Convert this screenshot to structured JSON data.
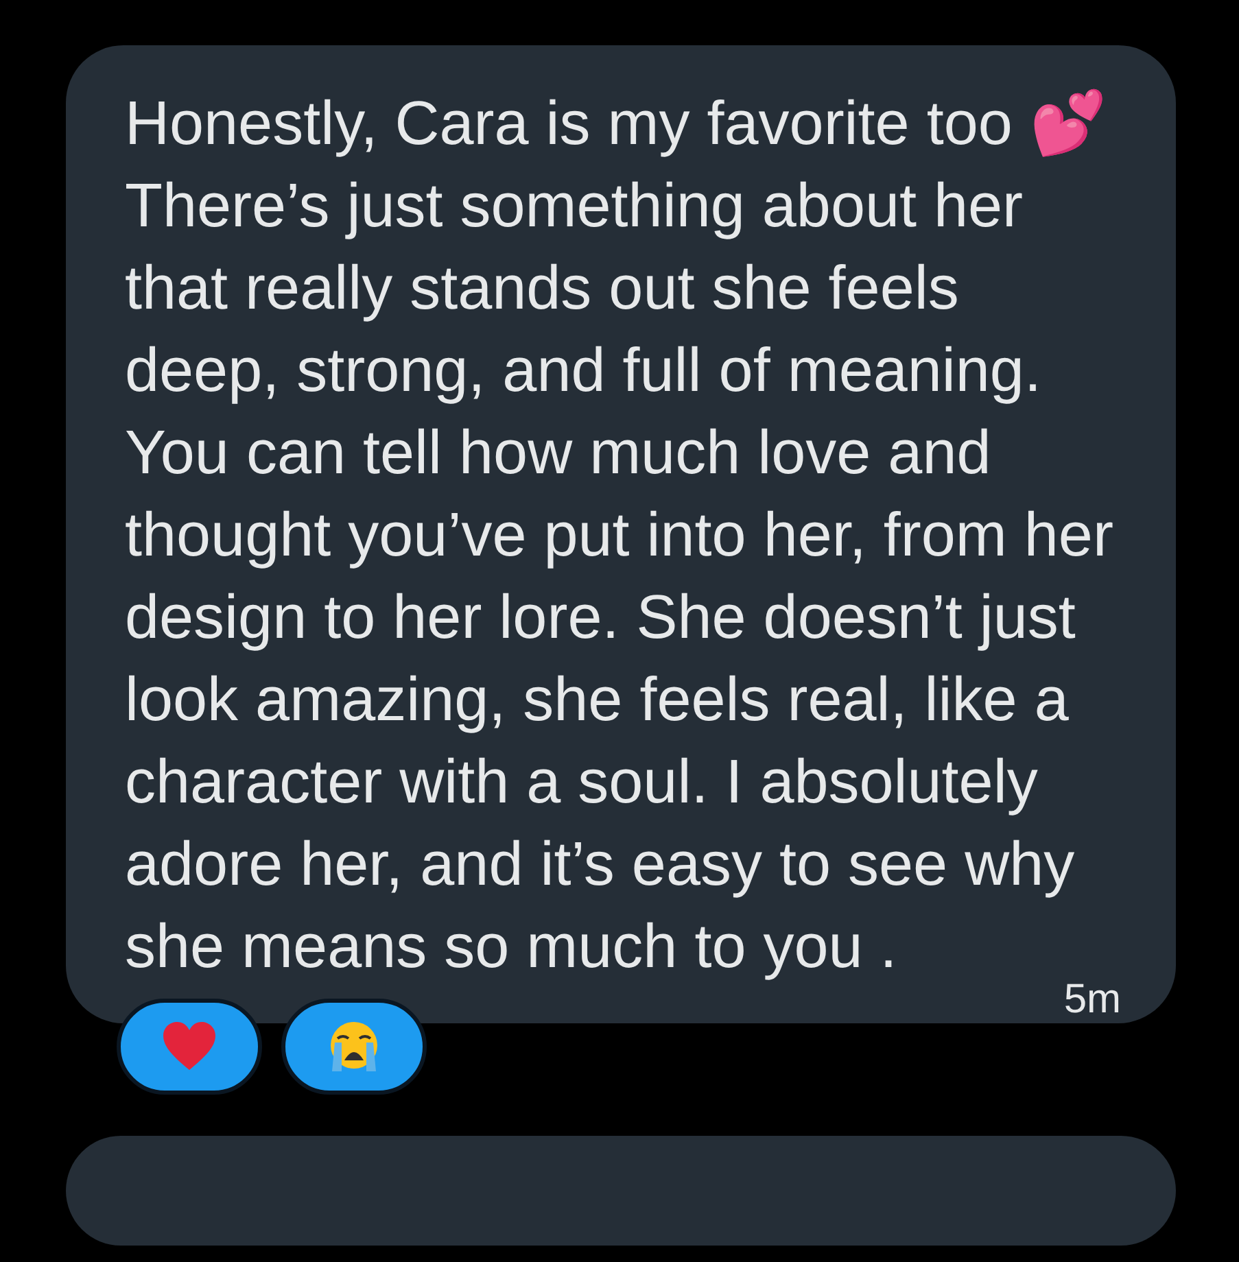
{
  "messages": [
    {
      "text": "Honestly, Cara is my favorite too 💕 There’s just something about her that really stands out she feels deep, strong, and full of meaning. You can tell how much love and thought you’ve put into her, from her design to her lore. She doesn’t just look amazing, she feels real, like a character with a soul. I absolutely adore her, and it’s easy to see why she means so much to you .",
      "time": "5m",
      "reactions": [
        {
          "kind": "heart"
        },
        {
          "kind": "crying-face"
        }
      ]
    }
  ]
}
